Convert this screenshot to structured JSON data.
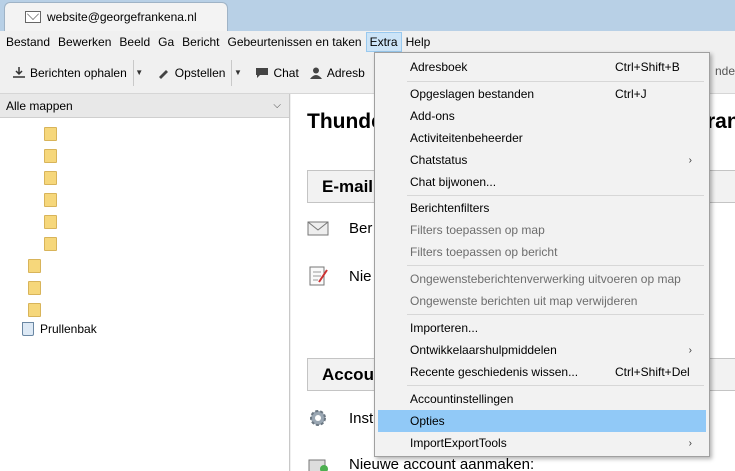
{
  "tab": {
    "title": "website@georgefrankena.nl",
    "icon": "mail-icon"
  },
  "menubar": [
    {
      "label": "Bestand"
    },
    {
      "label": "Bewerken"
    },
    {
      "label": "Beeld"
    },
    {
      "label": "Ga"
    },
    {
      "label": "Bericht"
    },
    {
      "label": "Gebeurtenissen en taken"
    },
    {
      "label": "Extra",
      "active": true
    },
    {
      "label": "Help"
    }
  ],
  "toolbar": {
    "get_messages": "Berichten ophalen",
    "compose": "Opstellen",
    "chat": "Chat",
    "address": "Adresb",
    "right_fragment": "nde"
  },
  "folder_pane": {
    "header": "Alle mappen",
    "trash": "Prullenbak"
  },
  "main": {
    "title": "Thunde",
    "title_right": "ran",
    "section_email": "E-mail",
    "entry_read": "Ber",
    "entry_new": "Nie",
    "section_accounts": "Accou",
    "entry_settings": "Inst",
    "entry_new_account": "Nieuwe account aanmaken:"
  },
  "dropdown": {
    "items": [
      {
        "label": "Adresboek",
        "shortcut": "Ctrl+Shift+B"
      },
      {
        "label": "Opgeslagen bestanden",
        "shortcut": "Ctrl+J"
      },
      {
        "label": "Add-ons"
      },
      {
        "label": "Activiteitenbeheerder"
      },
      {
        "label": "Chatstatus",
        "submenu": true
      },
      {
        "label": "Chat bijwonen..."
      },
      {
        "label": "Berichtenfilters"
      },
      {
        "label": "Filters toepassen op map",
        "disabled": true
      },
      {
        "label": "Filters toepassen op bericht",
        "disabled": true
      },
      {
        "label": "Ongewensteberichtenverwerking uitvoeren op map",
        "disabled": true
      },
      {
        "label": "Ongewenste berichten uit map verwijderen",
        "disabled": true
      },
      {
        "label": "Importeren..."
      },
      {
        "label": "Ontwikkelaarshulpmiddelen",
        "submenu": true
      },
      {
        "label": "Recente geschiedenis wissen...",
        "shortcut": "Ctrl+Shift+Del"
      },
      {
        "label": "Accountinstellingen"
      },
      {
        "label": "Opties",
        "highlight": true
      },
      {
        "label": "ImportExportTools",
        "submenu": true
      }
    ],
    "submenu_arrow": "›"
  },
  "colors": {
    "highlight": "#91c9f7",
    "titlebar": "#b8d0e6",
    "menu_active": "#cce4f7"
  }
}
